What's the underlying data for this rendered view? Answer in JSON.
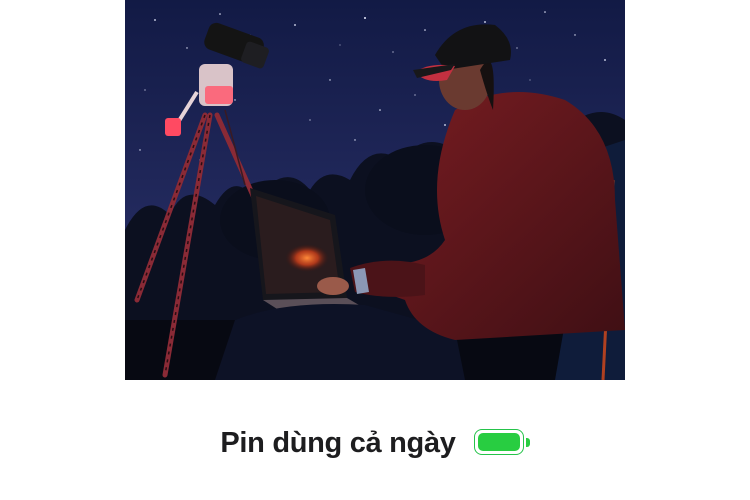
{
  "caption": {
    "text": "Pin dùng cả ngày"
  },
  "battery": {
    "level": 1.0,
    "color": "#28cd41",
    "icon": "battery-full-icon"
  },
  "photo": {
    "scene": "night-astrophotography-photo",
    "palette": {
      "sky_top": "#121a45",
      "sky_bottom": "#2b2f66",
      "tree": "#0c1020",
      "jacket": "#6e1a1f",
      "red_light": "#ff3a52"
    }
  }
}
